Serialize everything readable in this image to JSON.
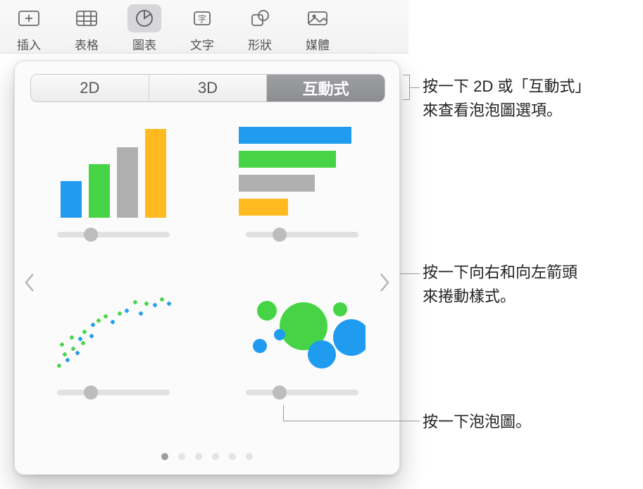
{
  "toolbar": {
    "insert_label": "插入",
    "table_label": "表格",
    "chart_label": "圖表",
    "text_label": "文字",
    "shape_label": "形狀",
    "media_label": "媒體"
  },
  "segmented": {
    "tab_2d": "2D",
    "tab_3d": "3D",
    "tab_interactive": "互動式"
  },
  "chart_tiles": {
    "bar_vertical": "直條圖",
    "bar_horizontal": "橫條圖",
    "scatter": "散佈圖",
    "bubble": "泡泡圖"
  },
  "page_dots": {
    "count": 6,
    "active_index": 0
  },
  "callouts": {
    "tabs_line1": "按一下 2D 或「互動式」",
    "tabs_line2": "來查看泡泡圖選項。",
    "arrows_line1": "按一下向右和向左箭頭",
    "arrows_line2": "來捲動樣式。",
    "bubble": "按一下泡泡圖。"
  },
  "colors": {
    "blue": "#1f9cf0",
    "green": "#46d446",
    "grey": "#b0b0b0",
    "yellow": "#ffba1f"
  }
}
